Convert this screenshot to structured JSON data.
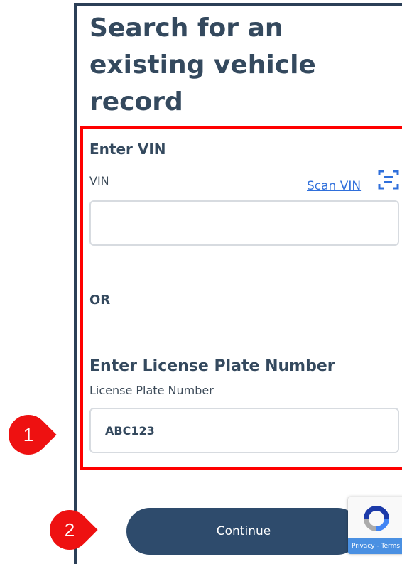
{
  "page": {
    "title": "Search for an existing vehicle record"
  },
  "vin_section": {
    "heading": "Enter VIN",
    "field_label": "VIN",
    "scan_link": "Scan VIN",
    "scan_icon": "scan-document-icon",
    "value": ""
  },
  "separator": {
    "label": "OR"
  },
  "plate_section": {
    "heading": "Enter License Plate Number",
    "field_label": "License Plate Number",
    "value": "ABC123"
  },
  "actions": {
    "continue_label": "Continue"
  },
  "recaptcha": {
    "links": "Privacy - Terms"
  },
  "annotations": {
    "callout_1": "1",
    "callout_2": "2"
  },
  "colors": {
    "primary": "#2e4b6c",
    "highlight": "#ff0000",
    "link": "#2f6fdb",
    "callout": "#ee1111"
  }
}
